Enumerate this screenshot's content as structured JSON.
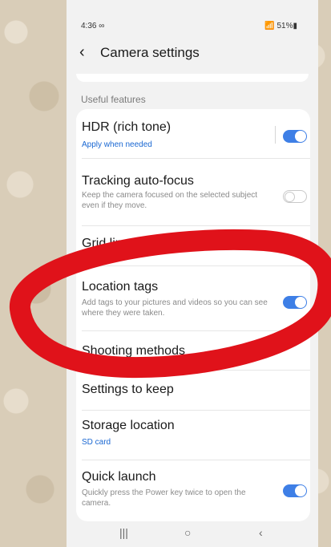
{
  "status_bar": {
    "time": "4:36 ∞",
    "indicators": "📶 51%▮"
  },
  "app_bar": {
    "back_icon": "‹",
    "title": "Camera settings"
  },
  "section": {
    "title": "Useful features"
  },
  "settings": [
    {
      "title": "HDR (rich tone)",
      "subtitle": "Apply when needed",
      "toggle": "on"
    },
    {
      "title": "Tracking auto-focus",
      "subtitle": "Keep the camera focused on the selected subject even if they move.",
      "toggle": "off"
    },
    {
      "title": "Grid lines",
      "toggle": "off"
    },
    {
      "title": "Location tags",
      "subtitle": "Add tags to your pictures and videos so you can see where they were taken.",
      "toggle": "on"
    },
    {
      "title": "Shooting methods"
    },
    {
      "title": "Settings to keep"
    },
    {
      "title": "Storage location",
      "subtitle": "SD card"
    },
    {
      "title": "Quick launch",
      "subtitle": "Quickly press the Power key twice to open the camera.",
      "toggle": "on"
    }
  ],
  "nav_bar": {
    "recents": "|||",
    "home": "○",
    "back": "‹"
  },
  "colors": {
    "toggle_on": "#3e7fe6",
    "link_blue": "#1967d2",
    "annotation_red": "#e0121a"
  }
}
